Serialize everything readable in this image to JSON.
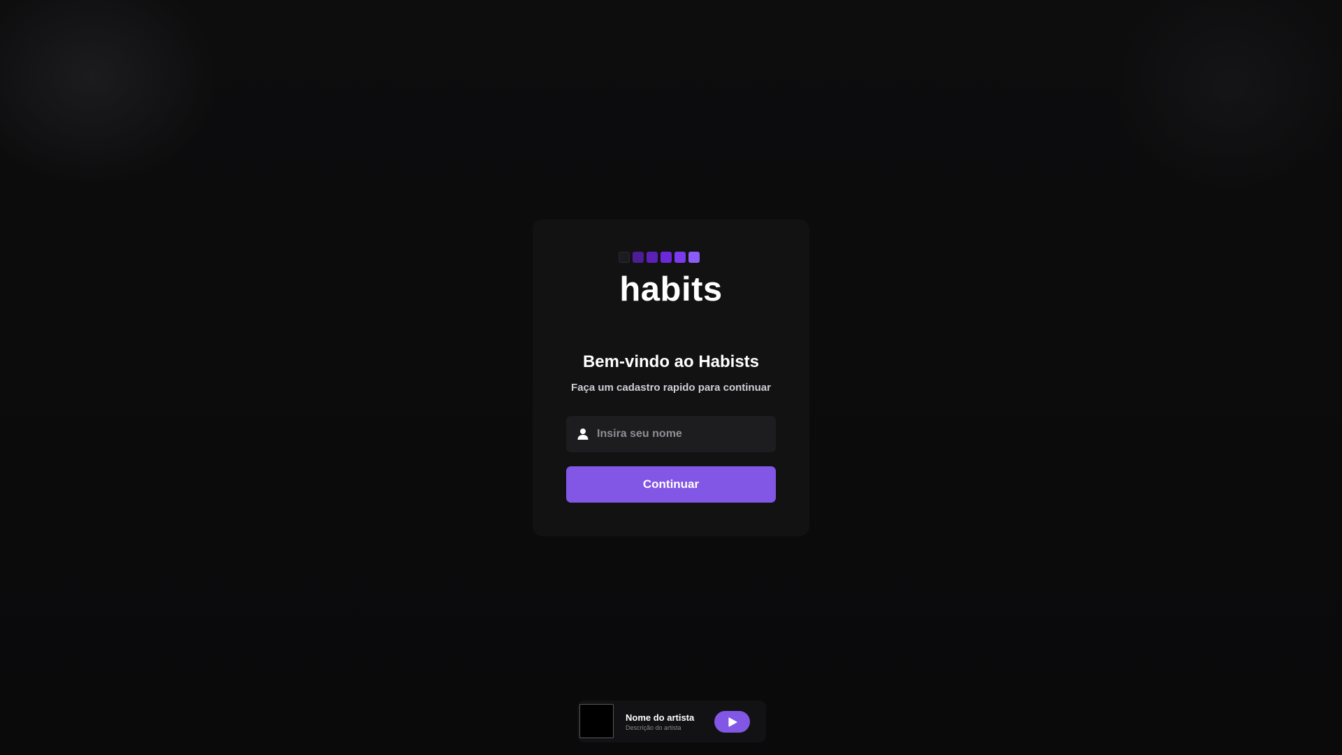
{
  "brand": {
    "logo_text": "habits",
    "logo_squares": [
      "#1c1b22",
      "#4c1d95",
      "#5b21b6",
      "#6d28d9",
      "#7c3aed",
      "#8b5cf6"
    ]
  },
  "signup": {
    "title": "Bem-vindo ao Habists",
    "subtitle": "Faça um cadastro rapido para continuar",
    "name_placeholder": "Insira seu nome",
    "name_value": "",
    "continue_label": "Continuar"
  },
  "player": {
    "artist_name": "Nome do artista",
    "artist_description": "Descrição do artista",
    "play_icon": "play-icon"
  },
  "colors": {
    "accent": "#8257e5",
    "background": "#0b0b0c",
    "card": "#121213",
    "input": "#1d1d20"
  }
}
